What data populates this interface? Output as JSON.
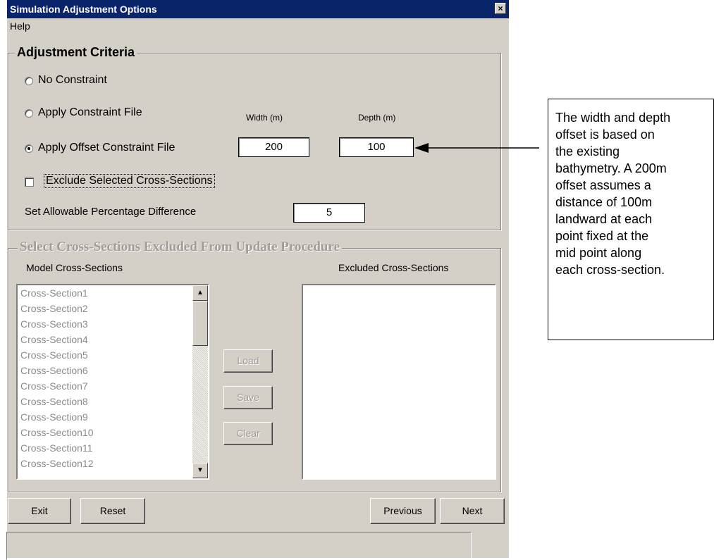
{
  "window": {
    "title": "Simulation Adjustment Options",
    "close_glyph": "×"
  },
  "menu": {
    "help": "Help"
  },
  "criteria": {
    "legend": "Adjustment Criteria",
    "no_constraint": "No Constraint",
    "apply_constraint": "Apply Constraint File",
    "apply_offset": "Apply Offset Constraint File",
    "width_label": "Width (m)",
    "depth_label": "Depth (m)",
    "width_value": "200",
    "depth_value": "100",
    "selected_option": "apply_offset",
    "exclude_label": "Exclude Selected Cross-Sections",
    "exclude_checked": false,
    "pct_label": "Set Allowable Percentage Difference",
    "pct_value": "5"
  },
  "exclusion": {
    "legend": "Select Cross-Sections Excluded From Update Procedure",
    "model_header": "Model Cross-Sections",
    "excluded_header": "Excluded Cross-Sections",
    "model_items": [
      "Cross-Section1",
      "Cross-Section2",
      "Cross-Section3",
      "Cross-Section4",
      "Cross-Section5",
      "Cross-Section6",
      "Cross-Section7",
      "Cross-Section8",
      "Cross-Section9",
      "Cross-Section10",
      "Cross-Section11",
      "Cross-Section12"
    ],
    "load": "Load",
    "save": "Save",
    "clear": "Clear"
  },
  "footer": {
    "exit": "Exit",
    "reset": "Reset",
    "previous": "Previous",
    "next": "Next"
  },
  "annotation": {
    "lines": [
      "The width and depth",
      "offset is based on",
      "the existing",
      "bathymetry. A 200m",
      "offset assumes a",
      "distance of 100m",
      "landward at each",
      "point fixed at the",
      "mid point along",
      "each cross-section."
    ]
  }
}
